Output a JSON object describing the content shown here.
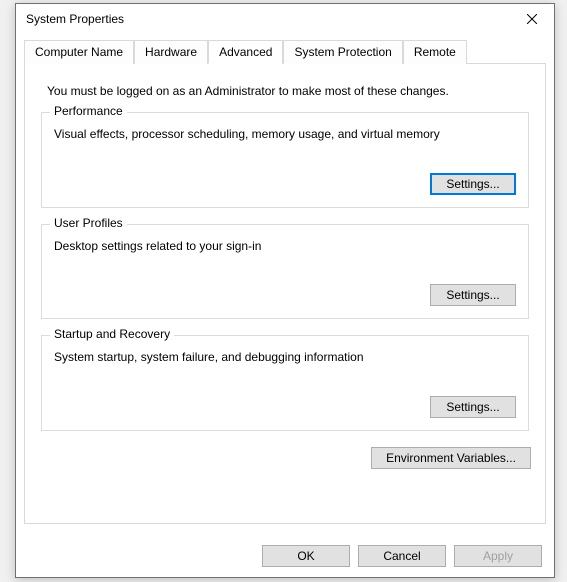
{
  "window": {
    "title": "System Properties"
  },
  "tabs": {
    "computer_name": "Computer Name",
    "hardware": "Hardware",
    "advanced": "Advanced",
    "system_protection": "System Protection",
    "remote": "Remote"
  },
  "advanced_panel": {
    "admin_note": "You must be logged on as an Administrator to make most of these changes.",
    "performance": {
      "title": "Performance",
      "desc": "Visual effects, processor scheduling, memory usage, and virtual memory",
      "settings_btn": "Settings..."
    },
    "user_profiles": {
      "title": "User Profiles",
      "desc": "Desktop settings related to your sign-in",
      "settings_btn": "Settings..."
    },
    "startup_recovery": {
      "title": "Startup and Recovery",
      "desc": "System startup, system failure, and debugging information",
      "settings_btn": "Settings..."
    },
    "env_vars_btn": "Environment Variables..."
  },
  "footer": {
    "ok": "OK",
    "cancel": "Cancel",
    "apply": "Apply"
  }
}
